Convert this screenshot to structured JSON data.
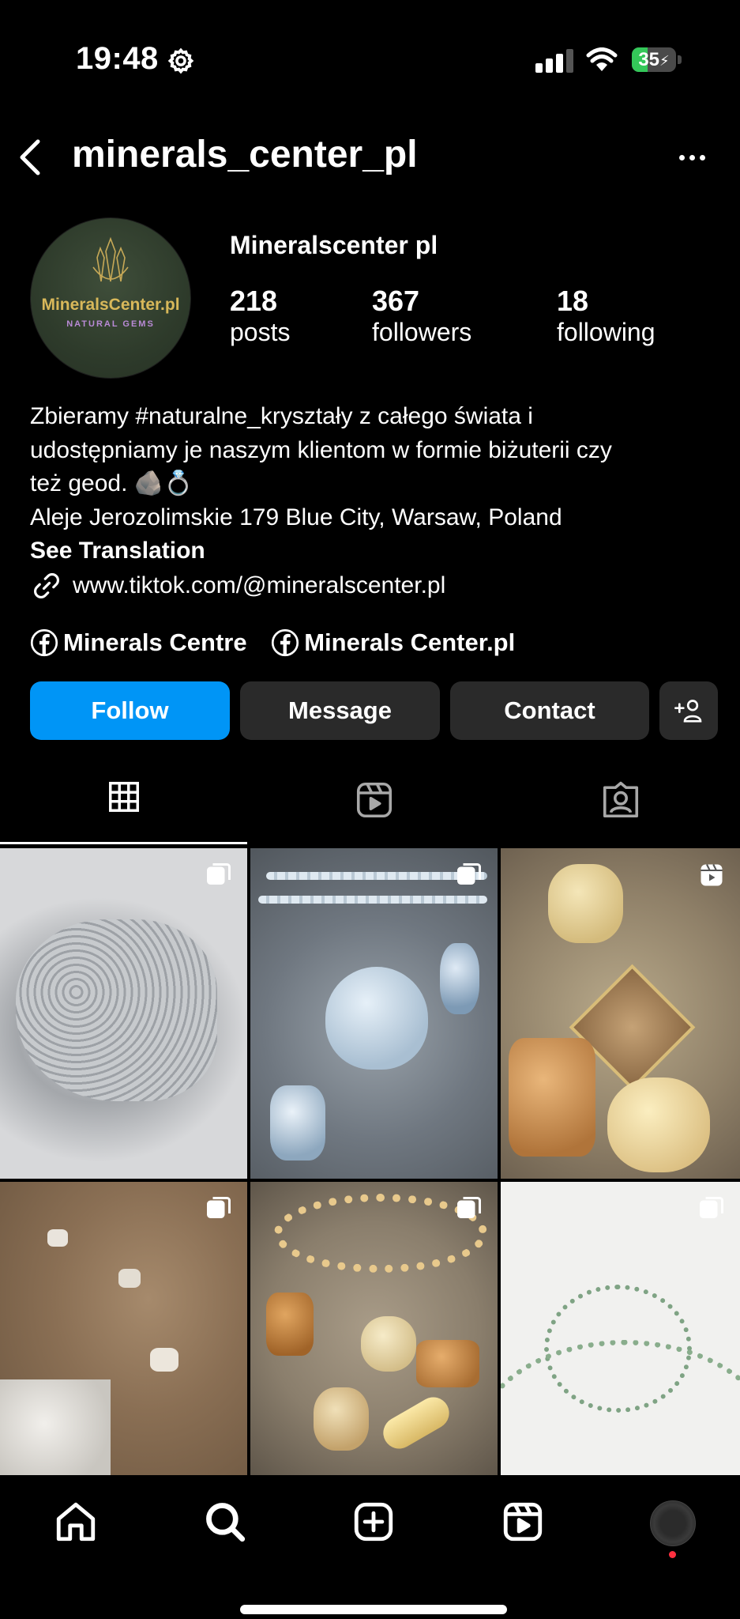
{
  "status_bar": {
    "time": "19:48",
    "battery": "35"
  },
  "header": {
    "username": "minerals_center_pl"
  },
  "profile": {
    "avatar_brand": "MineralsCenter.pl",
    "avatar_sub": "NATURAL GEMS",
    "display_name": "Mineralscenter pl",
    "stats": [
      {
        "value": "218",
        "label": "posts"
      },
      {
        "value": "367",
        "label": "followers"
      },
      {
        "value": "18",
        "label": "following"
      }
    ],
    "bio_lines": [
      "Zbieramy #naturalne_kryształy z całego świata i",
      "udostępniamy je naszym klientom w formie biżuterii czy",
      "też geod. 🪨💍",
      "Aleje Jerozolimskie 179 Blue City, Warsaw, Poland"
    ],
    "see_translation": "See Translation",
    "link": "www.tiktok.com/@mineralscenter.pl",
    "facebook_links": [
      "Minerals Centre",
      "Minerals Center.pl"
    ]
  },
  "actions": {
    "follow": "Follow",
    "message": "Message",
    "contact": "Contact"
  },
  "tabs": [
    "posts-grid",
    "reels",
    "tagged"
  ],
  "grid": [
    {
      "type": "carousel",
      "subject": "grey druzy geode"
    },
    {
      "type": "carousel",
      "subject": "opalite pendants"
    },
    {
      "type": "reel",
      "subject": "yellow jade stones"
    },
    {
      "type": "carousel",
      "subject": "mineral specimen"
    },
    {
      "type": "carousel",
      "subject": "stone bracelets and pendants"
    },
    {
      "type": "carousel",
      "subject": "green aventurine necklace"
    }
  ],
  "colors": {
    "accent": "#0095f6",
    "button_bg": "#2a2a2a",
    "background": "#000000",
    "notification_dot": "#ff3040"
  }
}
